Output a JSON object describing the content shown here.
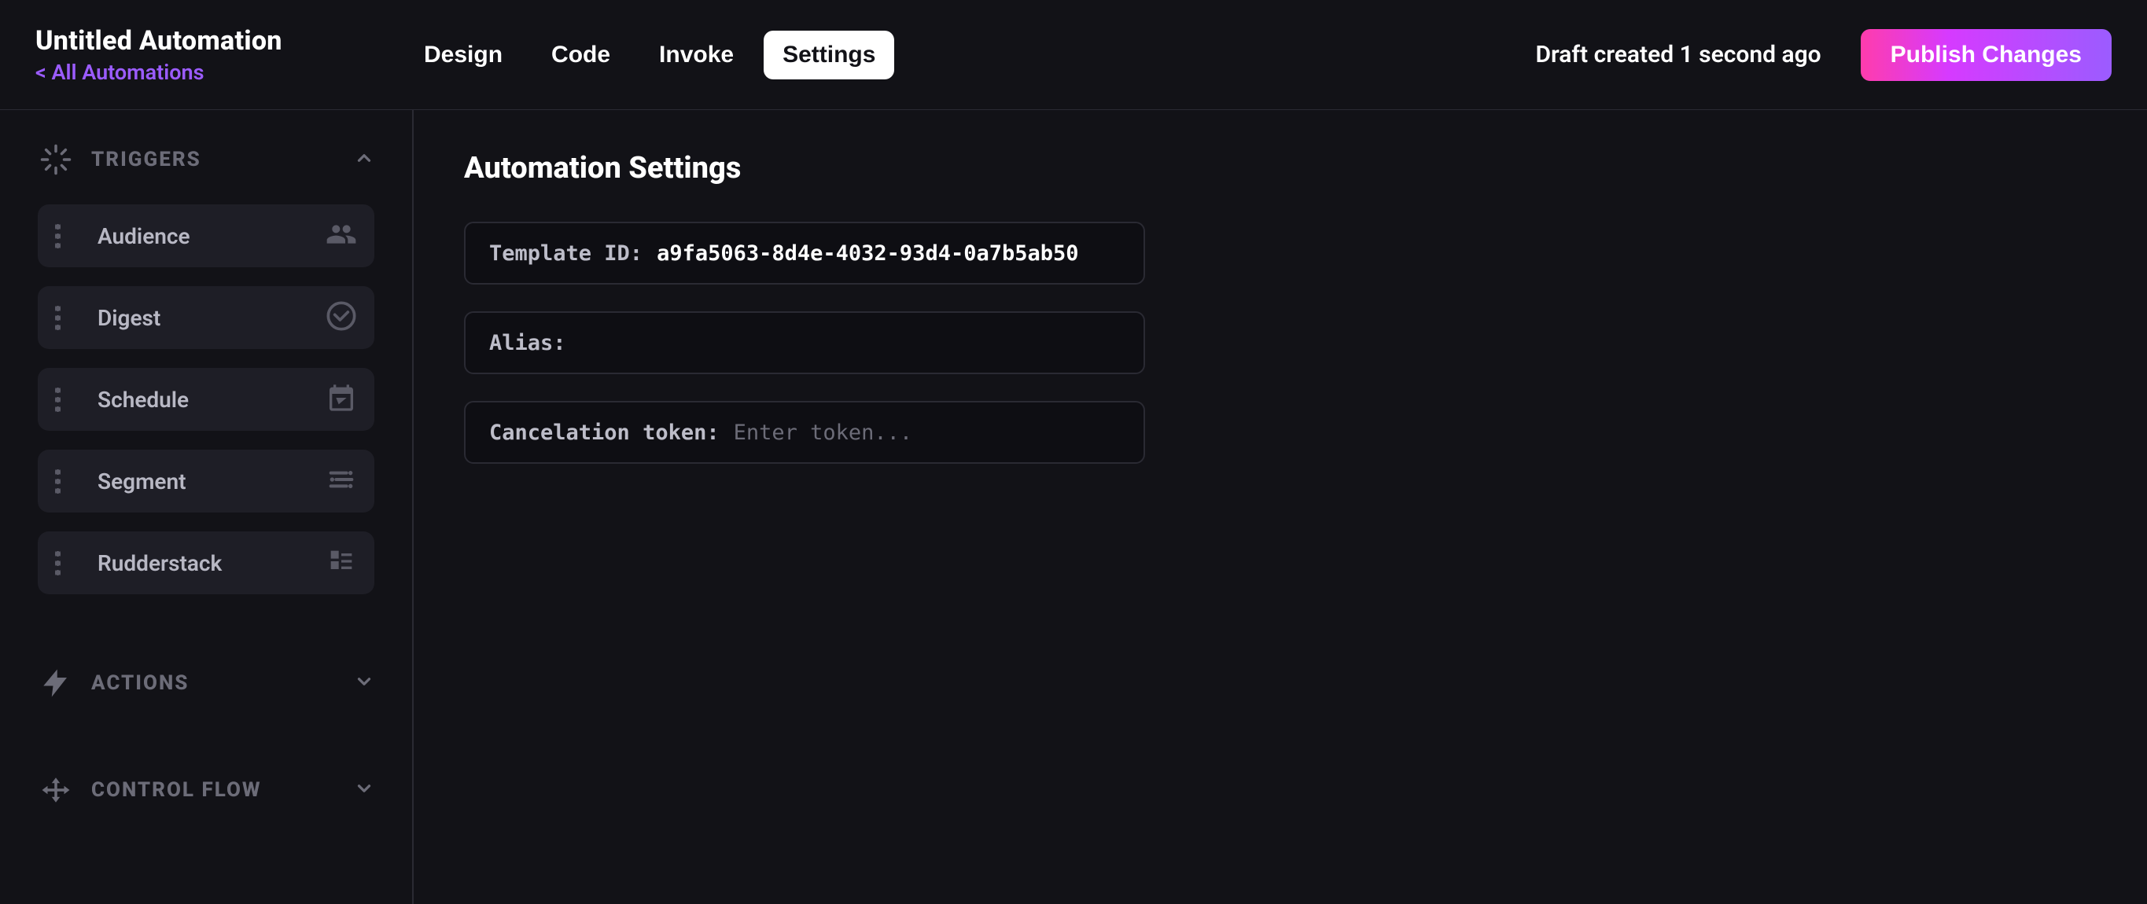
{
  "header": {
    "title": "Untitled Automation",
    "back_link": "< All Automations",
    "tabs": {
      "design": "Design",
      "code": "Code",
      "invoke": "Invoke",
      "settings": "Settings"
    },
    "status": "Draft created 1 second ago",
    "publish": "Publish Changes"
  },
  "sidebar": {
    "triggers_label": "TRIGGERS",
    "actions_label": "ACTIONS",
    "control_flow_label": "CONTROL FLOW",
    "triggers": {
      "audience": "Audience",
      "digest": "Digest",
      "schedule": "Schedule",
      "segment": "Segment",
      "rudderstack": "Rudderstack"
    }
  },
  "main": {
    "heading": "Automation Settings",
    "template_id_label": "Template ID:",
    "template_id_value": "a9fa5063-8d4e-4032-93d4-0a7b5ab50",
    "alias_label": "Alias:",
    "alias_value": "",
    "cancel_label": "Cancelation token:",
    "cancel_placeholder": "Enter token..."
  }
}
